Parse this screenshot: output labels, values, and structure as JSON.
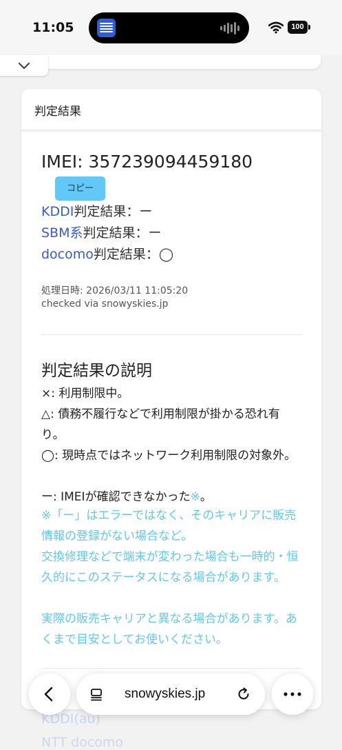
{
  "status_bar": {
    "time": "11:05",
    "battery": "100"
  },
  "card": {
    "title": "判定結果",
    "imei_label": "IMEI: ",
    "imei_value": "357239094459180",
    "copy_label": "コピー",
    "carriers": [
      {
        "name": "KDDI",
        "suffix": "判定結果：ー"
      },
      {
        "name": "SBM系",
        "suffix": "判定結果：ー"
      },
      {
        "name": "docomo",
        "suffix": "判定結果：◯"
      }
    ],
    "processed_at": "処理日時: 2026/03/11 11:05:20",
    "checked_via": "checked via snowyskies.jp",
    "explanation": {
      "title": "判定結果の説明",
      "items": [
        "×: 利用制限中。",
        "△: 債務不履行などで利用制限が掛かる恐れ有り。",
        "◯: 現時点ではネットワーク利用制限の対象外。",
        "ー: IMEIが確認できなかった"
      ],
      "note_mark": "※",
      "period": "。",
      "notes": [
        "※「ー」はエラーではなく、そのキャリアに販売情報の登録がない場合など。",
        "交換修理などで端末が変わった場合も一時的・恒久的にこのステータスになる場合があります。",
        "実際の販売キャリアと異なる場合があります。あくまで目安としてお使いください。"
      ]
    }
  },
  "below": {
    "link_kddi": "KDDI(au)",
    "link_ntt": "NTT docomo"
  },
  "toolbar": {
    "address": "snowyskies.jp"
  },
  "colors": {
    "link": "#3b5bc6",
    "copy_button": "#63c8f5",
    "note": "#62c8ec"
  }
}
